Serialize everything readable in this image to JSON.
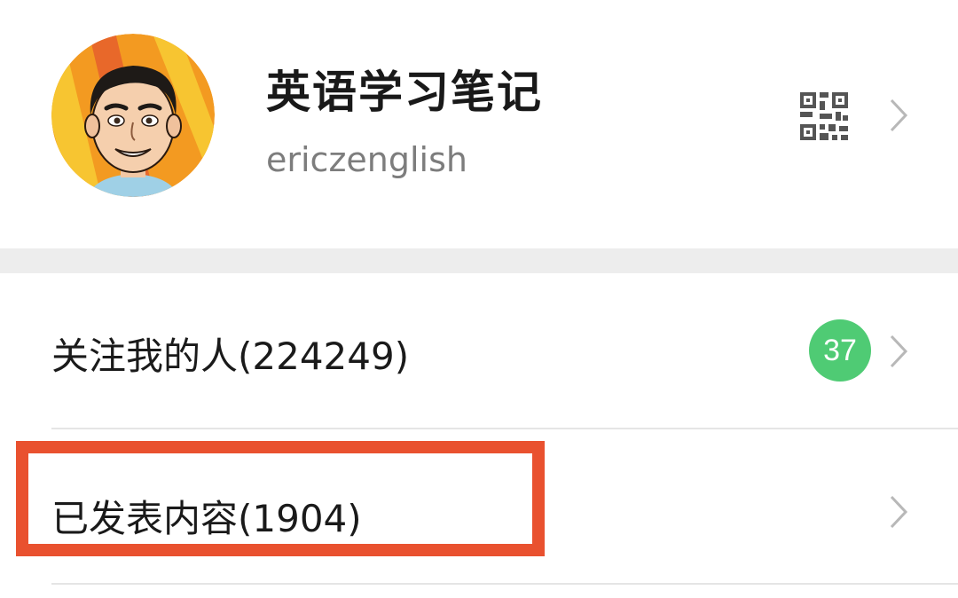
{
  "profile": {
    "name": "英语学习笔记",
    "account_id": "ericzenglish",
    "avatar_icon": "cartoon-avatar-icon",
    "qr_icon": "qr-code-icon"
  },
  "menu": {
    "followers": {
      "label": "关注我的人(224249)",
      "badge": "37",
      "badge_color": "#4fcb74"
    },
    "published": {
      "label": "已发表内容(1904)"
    }
  },
  "colors": {
    "highlight": "#e9512f",
    "separator": "#ededed",
    "secondary_text": "#7d7d7d"
  }
}
